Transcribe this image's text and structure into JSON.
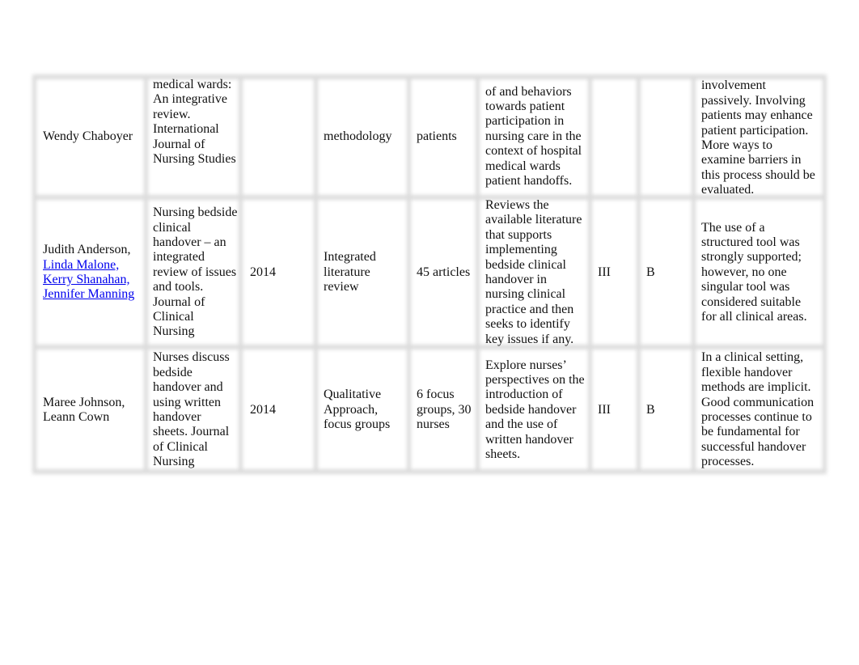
{
  "table": {
    "rows": [
      {
        "authors": [
          {
            "text": "Wendy Chaboyer",
            "link": false
          }
        ],
        "title": "medical wards:\nAn integrative\nreview.\nInternational\nJournal of\nNursing Studies",
        "year": "",
        "design": "methodology",
        "sample": "patients",
        "purpose": "of and behaviors\ntowards patient\nparticipation in\nnursing care in the\ncontext of hospital\nmedical wards\npatient handoffs.",
        "level": "",
        "quality": "",
        "findings": "involvement\npassively. Involving\npatients may enhance\npatient participation.\nMore ways to\nexamine barriers in\nthis process should be\nevaluated."
      },
      {
        "authors": [
          {
            "text": "Judith Anderson,",
            "link": false
          },
          {
            "text": "Linda Malone,",
            "link": true
          },
          {
            "text": "Kerry Shanahan,",
            "link": true
          },
          {
            "text": "Jennifer Manning",
            "link": true
          }
        ],
        "title": "Nursing bedside\nclinical\nhandover – an\nintegrated\nreview of issues\nand tools.\nJournal of\nClinical\nNursing",
        "year": "2014",
        "design": "Integrated\nliterature\nreview",
        "sample": "45 articles",
        "purpose": "Reviews the\navailable literature\nthat supports\nimplementing\nbedside clinical\nhandover in\nnursing clinical\npractice and then\nseeks to identify\nkey issues if any.",
        "level": "III",
        "quality": "B",
        "findings": "The use of a\nstructured tool was\nstrongly supported;\nhowever, no one\nsingular tool was\nconsidered suitable\nfor all clinical areas."
      },
      {
        "authors": [
          {
            "text": "Maree Johnson,",
            "link": false
          },
          {
            "text": "Leann Cown",
            "link": false
          }
        ],
        "title": "Nurses discuss\nbedside\nhandover and\nusing written\nhandover\nsheets. Journal\nof Clinical\nNursing",
        "year": "2014",
        "design": "Qualitative\nApproach,\nfocus groups",
        "sample": "6 focus\ngroups, 30\nnurses",
        "purpose": "Explore nurses’\nperspectives on the\nintroduction of\nbedside handover\nand the use of\nwritten handover\nsheets.",
        "level": "III",
        "quality": "B",
        "findings": "In a clinical setting,\nflexible handover\nmethods are implicit.\nGood communication\nprocesses continue to\nbe fundamental for\nsuccessful handover\nprocesses."
      }
    ]
  }
}
